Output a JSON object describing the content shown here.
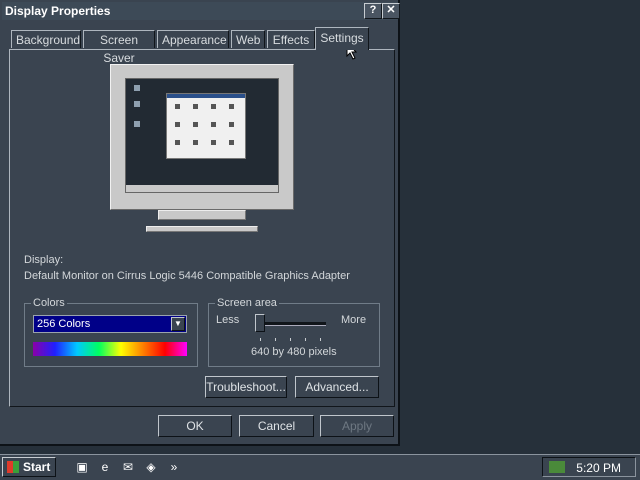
{
  "window": {
    "title": "Display Properties",
    "help_button": "?",
    "close_button": "✕"
  },
  "tabs": [
    "Background",
    "Screen Saver",
    "Appearance",
    "Web",
    "Effects",
    "Settings"
  ],
  "active_tab": "Settings",
  "display": {
    "label": "Display:",
    "value": "Default Monitor on Cirrus Logic 5446 Compatible Graphics Adapter"
  },
  "colors": {
    "legend": "Colors",
    "selected": "256 Colors"
  },
  "screen_area": {
    "legend": "Screen area",
    "less": "Less",
    "more": "More",
    "value_text": "640 by 480 pixels",
    "slider_level": 0
  },
  "buttons": {
    "troubleshoot": "Troubleshoot...",
    "advanced": "Advanced...",
    "ok": "OK",
    "cancel": "Cancel",
    "apply": "Apply"
  },
  "taskbar": {
    "start": "Start",
    "chevron": "»",
    "clock": "5:20 PM"
  },
  "icons": {
    "help": "question-mark-icon",
    "close": "close-icon",
    "dropdown": "chevron-down-icon"
  },
  "colors_theme": {
    "window_bg": "#3a4450",
    "desktop_bg": "#26303a",
    "select_bg": "#000088"
  }
}
